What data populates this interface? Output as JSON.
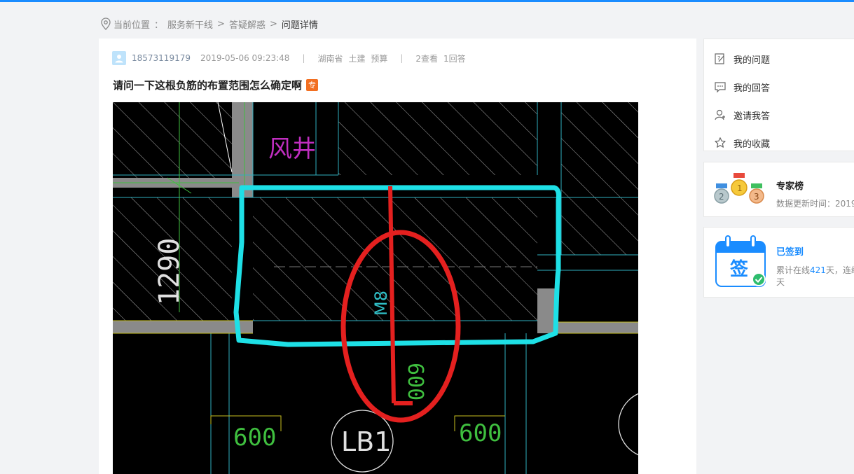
{
  "breadcrumb": {
    "label": "当前位置",
    "colon": "：",
    "items": [
      "服务新干线",
      "答疑解惑",
      "问题详情"
    ],
    "separator": ">"
  },
  "question": {
    "user": "18573119179",
    "time": "2019-05-06 09:23:48",
    "divider": "|",
    "region": "湖南省",
    "tags": [
      "土建",
      "预算"
    ],
    "views": "2查看",
    "answers": "1回答",
    "title": "请问一下这根负筋的布置范围怎么确定啊",
    "badge": "专"
  },
  "drawing": {
    "room_label": "风井",
    "dimension": "1290",
    "rebar_label": "M8",
    "length_red": "600",
    "length_left": "600",
    "length_right": "600",
    "slab_label": "LB1"
  },
  "sidebar": {
    "menu": [
      {
        "label": "我的问题",
        "icon": "edit-question-icon"
      },
      {
        "label": "我的回答",
        "icon": "comment-icon"
      },
      {
        "label": "邀请我答",
        "icon": "invite-user-icon"
      },
      {
        "label": "我的收藏",
        "icon": "star-icon"
      }
    ],
    "expert": {
      "title": "专家榜",
      "subtitle": "数据更新时间：2019"
    },
    "sign": {
      "title": "已签到",
      "stat_prefix": "累计在线",
      "days": "421",
      "stat_suffix": "天，连续",
      "line2": "天",
      "calendar_text": "签"
    }
  },
  "colors": {
    "accent": "#1a8cff",
    "badge": "#f26f21",
    "cad_cyan": "#1ee0e6",
    "cad_red": "#e4201f"
  }
}
